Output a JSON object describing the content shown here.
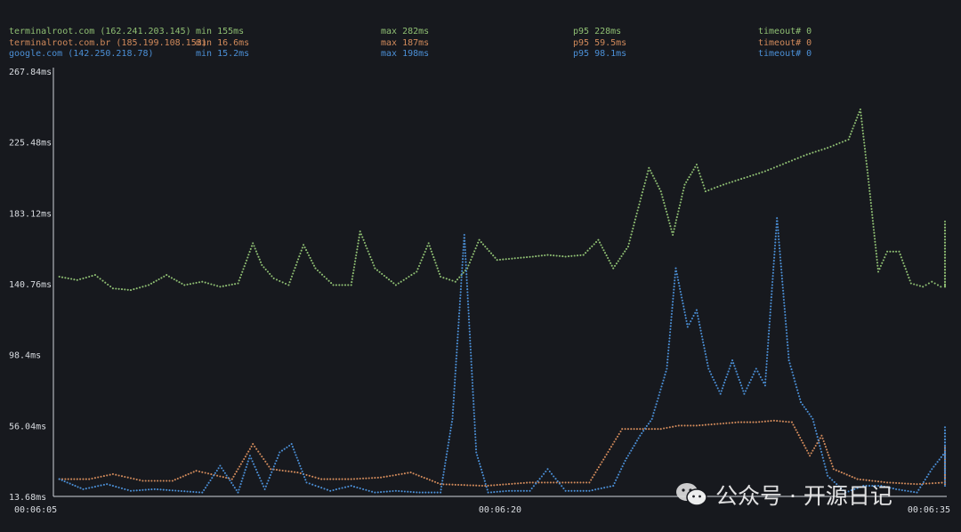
{
  "legend": [
    {
      "host": "terminalroot.com (162.241.203.145)",
      "min": "min 155ms",
      "max": "max 282ms",
      "p95": "p95 228ms",
      "timeout": "timeout# 0",
      "color": "#8fbf73"
    },
    {
      "host": "terminalroot.com.br (185.199.108.153)",
      "min": "min 16.6ms",
      "max": "max 187ms",
      "p95": "p95 59.5ms",
      "timeout": "timeout# 0",
      "color": "#d18a5b"
    },
    {
      "host": "google.com (142.250.218.78)",
      "min": "min 15.2ms",
      "max": "max 198ms",
      "p95": "p95 98.1ms",
      "timeout": "timeout# 0",
      "color": "#4b8fd6"
    }
  ],
  "watermark": {
    "text": "公众号 · 开源日记"
  },
  "chart_data": {
    "type": "scatter",
    "y_tick_labels": [
      "267.84ms",
      "225.48ms",
      "183.12ms",
      "140.76ms",
      "98.4ms",
      "56.04ms",
      "13.68ms"
    ],
    "y_ticks": [
      267.84,
      225.48,
      183.12,
      140.76,
      98.4,
      56.04,
      13.68
    ],
    "x_tick_labels": [
      "00:06:05",
      "00:06:20",
      "00:06:35"
    ],
    "x_ticks": [
      5,
      20,
      35
    ],
    "ylim": [
      13.68,
      267.84
    ],
    "xlim": [
      5,
      35
    ],
    "grid": false,
    "series": [
      {
        "name": "terminalroot.com (162.241.203.145)",
        "color": "#8fbf73",
        "points": [
          [
            5.2,
            145
          ],
          [
            5.8,
            143
          ],
          [
            6.4,
            146
          ],
          [
            7.0,
            138
          ],
          [
            7.6,
            137
          ],
          [
            8.2,
            140
          ],
          [
            8.8,
            146
          ],
          [
            9.4,
            140
          ],
          [
            10.0,
            142
          ],
          [
            10.6,
            139
          ],
          [
            11.2,
            141
          ],
          [
            11.7,
            165
          ],
          [
            12.0,
            152
          ],
          [
            12.4,
            144
          ],
          [
            12.9,
            140
          ],
          [
            13.4,
            164
          ],
          [
            13.8,
            150
          ],
          [
            14.4,
            140
          ],
          [
            15.0,
            140
          ],
          [
            15.3,
            172
          ],
          [
            15.8,
            150
          ],
          [
            16.5,
            140
          ],
          [
            17.2,
            148
          ],
          [
            17.6,
            165
          ],
          [
            18.0,
            145
          ],
          [
            18.5,
            142
          ],
          [
            18.9,
            150
          ],
          [
            19.3,
            167
          ],
          [
            19.9,
            155
          ],
          [
            20.5,
            156
          ],
          [
            21.1,
            157
          ],
          [
            21.6,
            158
          ],
          [
            22.2,
            157
          ],
          [
            22.8,
            158
          ],
          [
            23.3,
            167
          ],
          [
            23.8,
            150
          ],
          [
            24.3,
            163
          ],
          [
            24.7,
            190
          ],
          [
            25.0,
            210
          ],
          [
            25.4,
            196
          ],
          [
            25.8,
            170
          ],
          [
            26.2,
            200
          ],
          [
            26.6,
            212
          ],
          [
            26.9,
            196
          ],
          [
            27.5,
            200
          ],
          [
            28.2,
            204
          ],
          [
            28.9,
            208
          ],
          [
            29.6,
            213
          ],
          [
            30.3,
            218
          ],
          [
            31.0,
            222
          ],
          [
            31.7,
            227
          ],
          [
            32.1,
            245
          ],
          [
            32.4,
            198
          ],
          [
            32.7,
            148
          ],
          [
            33.0,
            160
          ],
          [
            33.4,
            160
          ],
          [
            33.8,
            141
          ],
          [
            34.2,
            139
          ],
          [
            34.5,
            142
          ],
          [
            34.8,
            139
          ],
          [
            35.3,
            140
          ],
          [
            35.7,
            139
          ],
          [
            36.3,
            140
          ],
          [
            36.9,
            140
          ],
          [
            37.4,
            178
          ],
          [
            37.8,
            142
          ],
          [
            38.3,
            139
          ]
        ]
      },
      {
        "name": "terminalroot.com.br (185.199.108.153)",
        "color": "#d18a5b",
        "points": [
          [
            5.2,
            24
          ],
          [
            6.2,
            24
          ],
          [
            7.0,
            27
          ],
          [
            8.0,
            23
          ],
          [
            9.0,
            23
          ],
          [
            9.8,
            29
          ],
          [
            11.0,
            24
          ],
          [
            11.7,
            45
          ],
          [
            12.3,
            30
          ],
          [
            13.2,
            28
          ],
          [
            14.0,
            24
          ],
          [
            15.0,
            24
          ],
          [
            16.0,
            25
          ],
          [
            17.0,
            28
          ],
          [
            18.0,
            21
          ],
          [
            19.5,
            20
          ],
          [
            21.0,
            22
          ],
          [
            23.0,
            22
          ],
          [
            24.1,
            54
          ],
          [
            24.8,
            54
          ],
          [
            25.4,
            54
          ],
          [
            26.0,
            56
          ],
          [
            26.6,
            56
          ],
          [
            27.3,
            57
          ],
          [
            28.0,
            58
          ],
          [
            28.6,
            58
          ],
          [
            29.2,
            59
          ],
          [
            29.8,
            58
          ],
          [
            30.4,
            38
          ],
          [
            30.8,
            50
          ],
          [
            31.2,
            30
          ],
          [
            32.0,
            24
          ],
          [
            33.0,
            22
          ],
          [
            34.0,
            21
          ],
          [
            35.0,
            22
          ],
          [
            36.0,
            21
          ],
          [
            36.6,
            40
          ],
          [
            37.0,
            26
          ],
          [
            37.5,
            43
          ],
          [
            38.0,
            25
          ]
        ]
      },
      {
        "name": "google.com (142.250.218.78)",
        "color": "#4b8fd6",
        "points": [
          [
            5.2,
            24
          ],
          [
            6.0,
            18
          ],
          [
            6.8,
            21
          ],
          [
            7.6,
            17
          ],
          [
            8.4,
            18
          ],
          [
            9.2,
            17
          ],
          [
            10.0,
            16
          ],
          [
            10.6,
            32
          ],
          [
            11.2,
            16
          ],
          [
            11.6,
            38
          ],
          [
            12.1,
            18
          ],
          [
            12.6,
            40
          ],
          [
            13.0,
            45
          ],
          [
            13.5,
            22
          ],
          [
            14.3,
            17
          ],
          [
            15.0,
            20
          ],
          [
            15.8,
            16
          ],
          [
            16.5,
            17
          ],
          [
            17.3,
            16
          ],
          [
            18.0,
            16
          ],
          [
            18.4,
            60
          ],
          [
            18.8,
            170
          ],
          [
            19.2,
            40
          ],
          [
            19.6,
            16
          ],
          [
            20.3,
            17
          ],
          [
            21.0,
            17
          ],
          [
            21.6,
            30
          ],
          [
            22.2,
            17
          ],
          [
            23.0,
            17
          ],
          [
            23.8,
            20
          ],
          [
            24.2,
            35
          ],
          [
            24.7,
            50
          ],
          [
            25.1,
            60
          ],
          [
            25.6,
            90
          ],
          [
            25.9,
            150
          ],
          [
            26.3,
            115
          ],
          [
            26.6,
            125
          ],
          [
            27.0,
            90
          ],
          [
            27.4,
            75
          ],
          [
            27.8,
            95
          ],
          [
            28.2,
            75
          ],
          [
            28.6,
            90
          ],
          [
            28.9,
            80
          ],
          [
            29.3,
            180
          ],
          [
            29.7,
            95
          ],
          [
            30.1,
            70
          ],
          [
            30.5,
            60
          ],
          [
            31.0,
            26
          ],
          [
            31.6,
            16
          ],
          [
            32.2,
            20
          ],
          [
            32.8,
            20
          ],
          [
            33.3,
            18
          ],
          [
            34.0,
            16
          ],
          [
            34.5,
            30
          ],
          [
            35.0,
            40
          ],
          [
            35.4,
            35
          ],
          [
            36.0,
            20
          ],
          [
            36.8,
            22
          ],
          [
            37.4,
            55
          ],
          [
            37.8,
            28
          ]
        ]
      }
    ]
  }
}
